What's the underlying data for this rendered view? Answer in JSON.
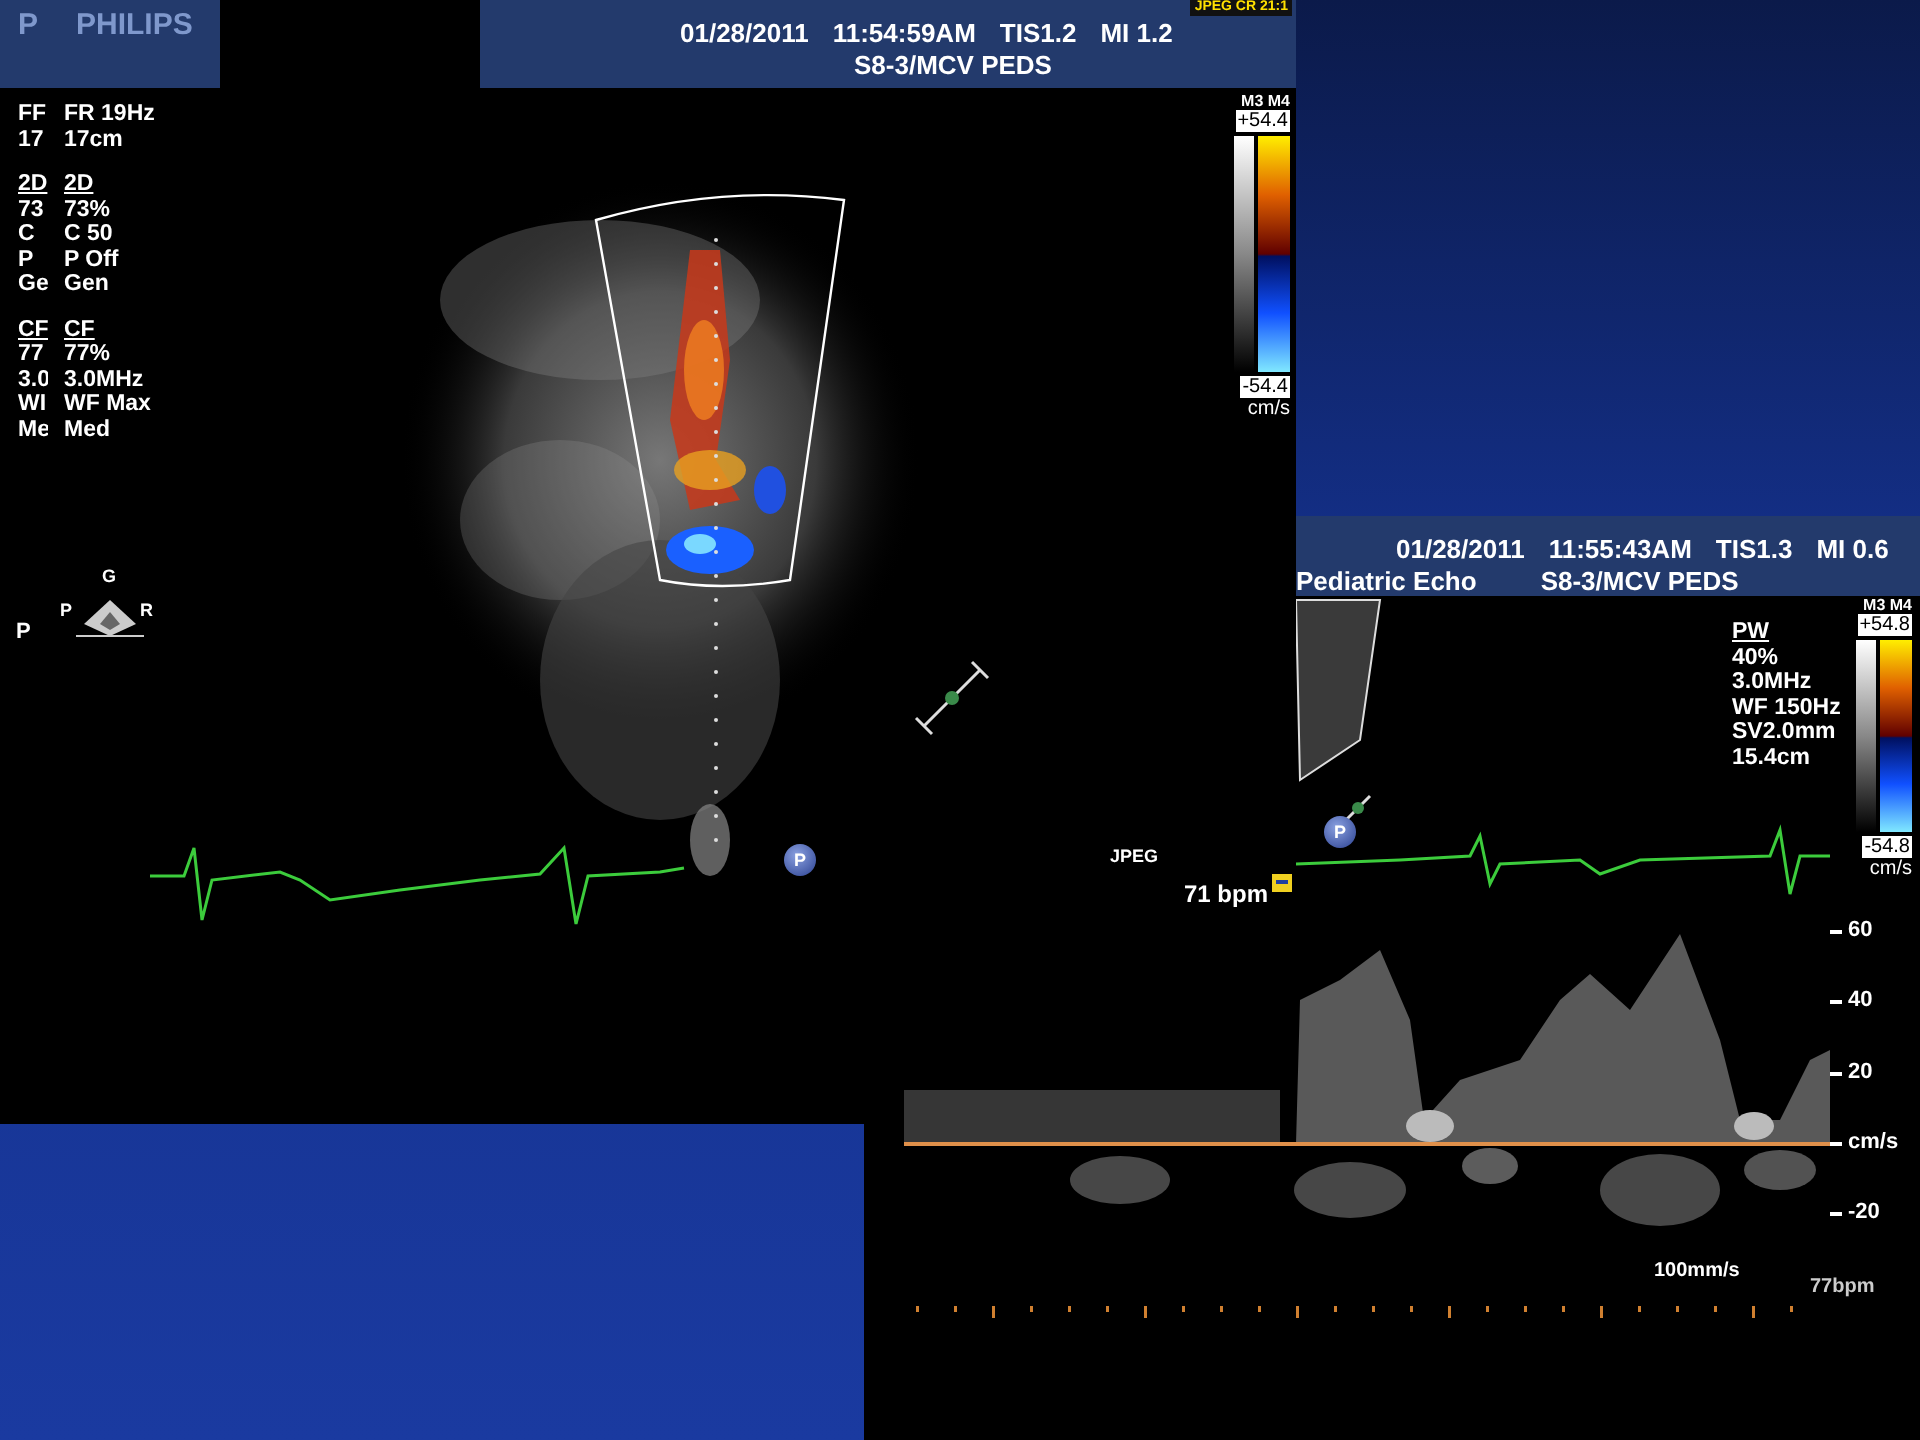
{
  "back_window": {
    "logo": "P",
    "orientation_left": "P",
    "info_groups": [
      {
        "lines": [
          "FF",
          "17"
        ]
      },
      {
        "heading": "2D",
        "lines": [
          "73",
          "C",
          "P",
          "Ge"
        ]
      },
      {
        "heading": "CF",
        "lines": [
          "77",
          "3.0",
          "WI",
          "Me"
        ]
      }
    ]
  },
  "main_window": {
    "logo": "PHILIPS",
    "date": "01/28/2011",
    "time": "11:54:59AM",
    "tis": "TIS1.2",
    "mi": "MI 1.2",
    "probe": "S8-3/MCV PEDS",
    "compression": "JPEG CR 21:1",
    "info_groups": [
      {
        "lines": [
          "FR 19Hz",
          "17cm"
        ]
      },
      {
        "heading": "2D",
        "lines": [
          "73%",
          "C 50",
          "P Off",
          "Gen"
        ]
      },
      {
        "heading": "CF",
        "lines": [
          "77%",
          "3.0MHz",
          "WF Max",
          "Med"
        ]
      }
    ],
    "orientation": {
      "top": "G",
      "left": "P",
      "right": "R"
    },
    "marker": "P",
    "format_label": "JPEG",
    "heart_rate": "71 bpm",
    "color_scale": {
      "modes": "M3 M4",
      "max": "+54.4",
      "min": "-54.4",
      "unit": "cm/s"
    }
  },
  "spectral_window": {
    "date": "01/28/2011",
    "time": "11:55:43AM",
    "tis": "TIS1.3",
    "mi": "MI 0.6",
    "preset": "Pediatric Echo",
    "probe": "S8-3/MCV PEDS",
    "info_groups": [
      {
        "heading": "PW",
        "lines": [
          "40%",
          "3.0MHz",
          "WF 150Hz",
          "SV2.0mm",
          "15.4cm"
        ]
      }
    ],
    "color_scale": {
      "modes": "M3 M4",
      "max": "+54.8",
      "min": "-54.8",
      "unit": "cm/s"
    },
    "marker": "P",
    "axis_labels": [
      "60",
      "40",
      "20",
      "cm/s",
      "-20"
    ],
    "sweep_speed": "100mm/s",
    "heart_rate": "77bpm"
  }
}
